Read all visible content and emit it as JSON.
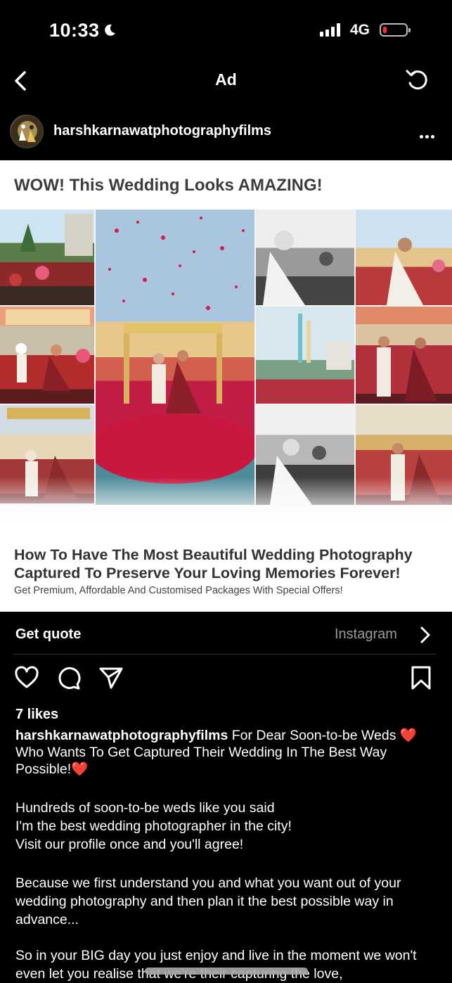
{
  "status_bar": {
    "time": "10:33",
    "network": "4G"
  },
  "nav": {
    "title": "Ad"
  },
  "post": {
    "username": "harshkarnawatphotographyfilms"
  },
  "ad": {
    "headline": "WOW! This Wedding Looks AMAZING!",
    "copy_line1": "How To Have The Most Beautiful Wedding Photography Captured To Preserve Your Loving Memories Forever!",
    "copy_line2": "Get Premium, Affordable And Customised Packages With Special Offers!"
  },
  "cta": {
    "label": "Get quote",
    "source": "Instagram"
  },
  "likes": "7 likes",
  "caption": {
    "username": "harshkarnawatphotographyfilms",
    "intro_a": "For Dear Soon-to-be Weds",
    "intro_b": "Who Wants To Get Captured Their Wedding In The Best Way Possible!",
    "para1": "Hundreds of soon-to-be weds like you said\nI'm the best wedding photographer in the city!\nVisit our profile once and you'll agree!",
    "para2": "Because we first understand you and what you want out of your wedding photography and then plan it the best possible way in advance...",
    "para3": "So in your BIG day you just enjoy and live in the moment we won't even let you realise that we're their capturing the love,"
  },
  "colors": {
    "background": "#000000",
    "heart": "#ff2d55",
    "battery_low": "#ff2d2d",
    "muted_text": "#9a9a9a"
  },
  "icons": [
    "moon-icon",
    "signal-icon",
    "battery-icon",
    "back-icon",
    "refresh-icon",
    "more-icon",
    "chevron-right-icon",
    "heart-icon",
    "comment-icon",
    "share-icon",
    "bookmark-icon"
  ]
}
